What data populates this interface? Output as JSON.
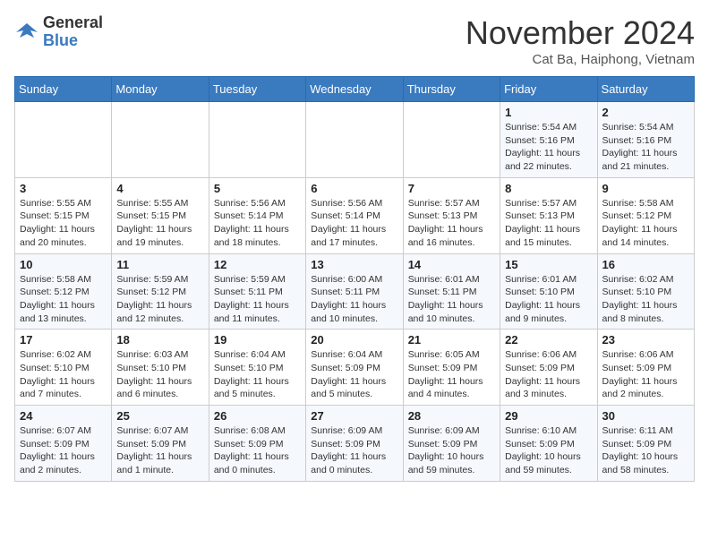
{
  "header": {
    "logo_general": "General",
    "logo_blue": "Blue",
    "month_title": "November 2024",
    "location": "Cat Ba, Haiphong, Vietnam"
  },
  "weekdays": [
    "Sunday",
    "Monday",
    "Tuesday",
    "Wednesday",
    "Thursday",
    "Friday",
    "Saturday"
  ],
  "weeks": [
    [
      {
        "day": "",
        "info": ""
      },
      {
        "day": "",
        "info": ""
      },
      {
        "day": "",
        "info": ""
      },
      {
        "day": "",
        "info": ""
      },
      {
        "day": "",
        "info": ""
      },
      {
        "day": "1",
        "info": "Sunrise: 5:54 AM\nSunset: 5:16 PM\nDaylight: 11 hours\nand 22 minutes."
      },
      {
        "day": "2",
        "info": "Sunrise: 5:54 AM\nSunset: 5:16 PM\nDaylight: 11 hours\nand 21 minutes."
      }
    ],
    [
      {
        "day": "3",
        "info": "Sunrise: 5:55 AM\nSunset: 5:15 PM\nDaylight: 11 hours\nand 20 minutes."
      },
      {
        "day": "4",
        "info": "Sunrise: 5:55 AM\nSunset: 5:15 PM\nDaylight: 11 hours\nand 19 minutes."
      },
      {
        "day": "5",
        "info": "Sunrise: 5:56 AM\nSunset: 5:14 PM\nDaylight: 11 hours\nand 18 minutes."
      },
      {
        "day": "6",
        "info": "Sunrise: 5:56 AM\nSunset: 5:14 PM\nDaylight: 11 hours\nand 17 minutes."
      },
      {
        "day": "7",
        "info": "Sunrise: 5:57 AM\nSunset: 5:13 PM\nDaylight: 11 hours\nand 16 minutes."
      },
      {
        "day": "8",
        "info": "Sunrise: 5:57 AM\nSunset: 5:13 PM\nDaylight: 11 hours\nand 15 minutes."
      },
      {
        "day": "9",
        "info": "Sunrise: 5:58 AM\nSunset: 5:12 PM\nDaylight: 11 hours\nand 14 minutes."
      }
    ],
    [
      {
        "day": "10",
        "info": "Sunrise: 5:58 AM\nSunset: 5:12 PM\nDaylight: 11 hours\nand 13 minutes."
      },
      {
        "day": "11",
        "info": "Sunrise: 5:59 AM\nSunset: 5:12 PM\nDaylight: 11 hours\nand 12 minutes."
      },
      {
        "day": "12",
        "info": "Sunrise: 5:59 AM\nSunset: 5:11 PM\nDaylight: 11 hours\nand 11 minutes."
      },
      {
        "day": "13",
        "info": "Sunrise: 6:00 AM\nSunset: 5:11 PM\nDaylight: 11 hours\nand 10 minutes."
      },
      {
        "day": "14",
        "info": "Sunrise: 6:01 AM\nSunset: 5:11 PM\nDaylight: 11 hours\nand 10 minutes."
      },
      {
        "day": "15",
        "info": "Sunrise: 6:01 AM\nSunset: 5:10 PM\nDaylight: 11 hours\nand 9 minutes."
      },
      {
        "day": "16",
        "info": "Sunrise: 6:02 AM\nSunset: 5:10 PM\nDaylight: 11 hours\nand 8 minutes."
      }
    ],
    [
      {
        "day": "17",
        "info": "Sunrise: 6:02 AM\nSunset: 5:10 PM\nDaylight: 11 hours\nand 7 minutes."
      },
      {
        "day": "18",
        "info": "Sunrise: 6:03 AM\nSunset: 5:10 PM\nDaylight: 11 hours\nand 6 minutes."
      },
      {
        "day": "19",
        "info": "Sunrise: 6:04 AM\nSunset: 5:10 PM\nDaylight: 11 hours\nand 5 minutes."
      },
      {
        "day": "20",
        "info": "Sunrise: 6:04 AM\nSunset: 5:09 PM\nDaylight: 11 hours\nand 5 minutes."
      },
      {
        "day": "21",
        "info": "Sunrise: 6:05 AM\nSunset: 5:09 PM\nDaylight: 11 hours\nand 4 minutes."
      },
      {
        "day": "22",
        "info": "Sunrise: 6:06 AM\nSunset: 5:09 PM\nDaylight: 11 hours\nand 3 minutes."
      },
      {
        "day": "23",
        "info": "Sunrise: 6:06 AM\nSunset: 5:09 PM\nDaylight: 11 hours\nand 2 minutes."
      }
    ],
    [
      {
        "day": "24",
        "info": "Sunrise: 6:07 AM\nSunset: 5:09 PM\nDaylight: 11 hours\nand 2 minutes."
      },
      {
        "day": "25",
        "info": "Sunrise: 6:07 AM\nSunset: 5:09 PM\nDaylight: 11 hours\nand 1 minute."
      },
      {
        "day": "26",
        "info": "Sunrise: 6:08 AM\nSunset: 5:09 PM\nDaylight: 11 hours\nand 0 minutes."
      },
      {
        "day": "27",
        "info": "Sunrise: 6:09 AM\nSunset: 5:09 PM\nDaylight: 11 hours\nand 0 minutes."
      },
      {
        "day": "28",
        "info": "Sunrise: 6:09 AM\nSunset: 5:09 PM\nDaylight: 10 hours\nand 59 minutes."
      },
      {
        "day": "29",
        "info": "Sunrise: 6:10 AM\nSunset: 5:09 PM\nDaylight: 10 hours\nand 59 minutes."
      },
      {
        "day": "30",
        "info": "Sunrise: 6:11 AM\nSunset: 5:09 PM\nDaylight: 10 hours\nand 58 minutes."
      }
    ]
  ]
}
